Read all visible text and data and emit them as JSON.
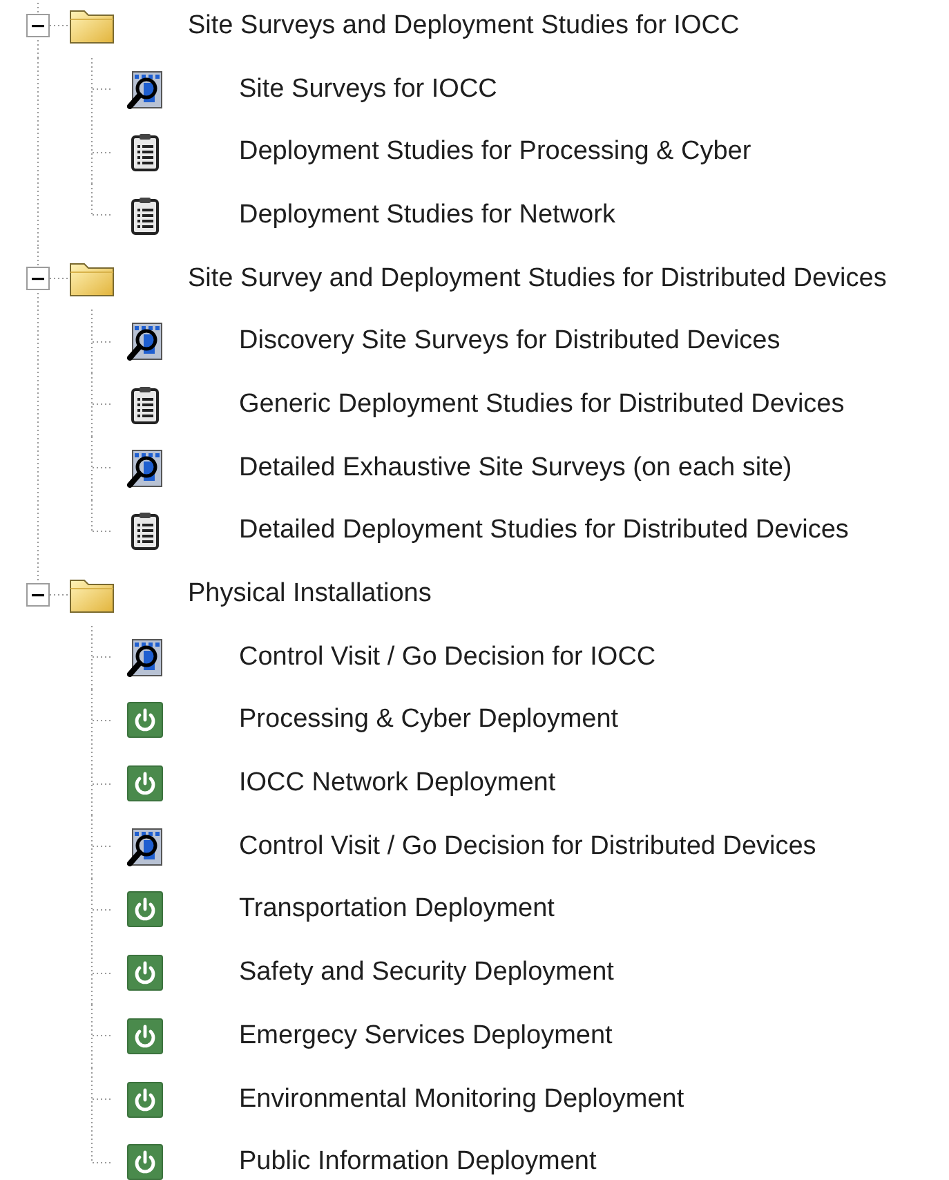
{
  "tree": [
    {
      "label": "Site Surveys and Deployment Studies for IOCC",
      "expanded": true,
      "children": [
        {
          "label": "Site Surveys for IOCC",
          "kind": "survey"
        },
        {
          "label": "Deployment Studies for Processing & Cyber",
          "kind": "checklist"
        },
        {
          "label": "Deployment Studies for Network",
          "kind": "checklist"
        }
      ]
    },
    {
      "label": "Site Survey and Deployment Studies for Distributed Devices",
      "expanded": true,
      "children": [
        {
          "label": "Discovery Site Surveys for Distributed Devices",
          "kind": "survey"
        },
        {
          "label": "Generic Deployment Studies for Distributed Devices",
          "kind": "checklist"
        },
        {
          "label": "Detailed Exhaustive Site Surveys (on each site)",
          "kind": "survey"
        },
        {
          "label": "Detailed Deployment Studies for Distributed Devices",
          "kind": "checklist"
        }
      ]
    },
    {
      "label": "Physical Installations",
      "expanded": true,
      "children": [
        {
          "label": "Control Visit / Go Decision for IOCC",
          "kind": "survey"
        },
        {
          "label": "Processing & Cyber Deployment",
          "kind": "power"
        },
        {
          "label": "IOCC Network Deployment",
          "kind": "power"
        },
        {
          "label": "Control Visit / Go Decision for Distributed Devices",
          "kind": "survey"
        },
        {
          "label": "Transportation Deployment",
          "kind": "power"
        },
        {
          "label": "Safety and Security Deployment",
          "kind": "power"
        },
        {
          "label": "Emergecy Services Deployment",
          "kind": "power"
        },
        {
          "label": "Environmental Monitoring Deployment",
          "kind": "power"
        },
        {
          "label": "Public Information Deployment",
          "kind": "power"
        }
      ]
    }
  ]
}
